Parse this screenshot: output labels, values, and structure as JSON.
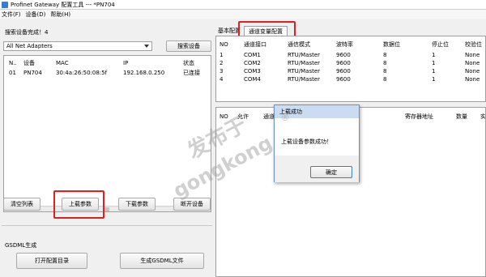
{
  "window": {
    "title": "Profinet Gateway 配置工具 --- *PN704"
  },
  "menu": {
    "items": [
      "文件(F)",
      "设备(D)",
      "帮助(H)"
    ]
  },
  "left": {
    "status": "搜索设备完成！4",
    "adapter": "All Net Adapters",
    "search_button": "搜索设备",
    "columns": [
      "N..",
      "设备",
      "MAC",
      "IP",
      "状态"
    ],
    "devices": [
      {
        "n": "01",
        "device": "PN704",
        "mac": "30:4a:26:50:08:5f",
        "ip": "192.168.0.250",
        "status": "已连接"
      }
    ],
    "buttons": {
      "clear": "清空列表",
      "upload": "上载参数",
      "download": "下载参数",
      "disconnect": "断开设备"
    },
    "gsdml": {
      "section": "GSDML生成",
      "open_dir": "打开配置目录",
      "generate": "生成GSDML文件"
    }
  },
  "right": {
    "tabs": [
      "基本配置",
      "通道变量配置"
    ],
    "channel_columns": [
      "NO",
      "通道接口",
      "通信模式",
      "波特率",
      "数据位",
      "停止位",
      "校验位"
    ],
    "channels": [
      {
        "no": "1",
        "port": "COM1",
        "mode": "RTU/Master",
        "baud": "9600",
        "data_bits": "8",
        "stop_bits": "1",
        "parity": "None"
      },
      {
        "no": "2",
        "port": "COM2",
        "mode": "RTU/Master",
        "baud": "9600",
        "data_bits": "8",
        "stop_bits": "1",
        "parity": "None"
      },
      {
        "no": "3",
        "port": "COM3",
        "mode": "RTU/Master",
        "baud": "9600",
        "data_bits": "8",
        "stop_bits": "1",
        "parity": "None"
      },
      {
        "no": "4",
        "port": "COM4",
        "mode": "RTU/Master",
        "baud": "9600",
        "data_bits": "8",
        "stop_bits": "1",
        "parity": "None"
      }
    ],
    "var_columns": [
      "NO",
      "允许",
      "通道",
      "寄存器地址",
      "数量",
      "实"
    ]
  },
  "dialog": {
    "title": "上载成功",
    "message": "上载设备参数成功！",
    "ok": "确定"
  },
  "watermark": {
    "line1": "发布于",
    "line2": "gongkong",
    "mark": "®"
  }
}
